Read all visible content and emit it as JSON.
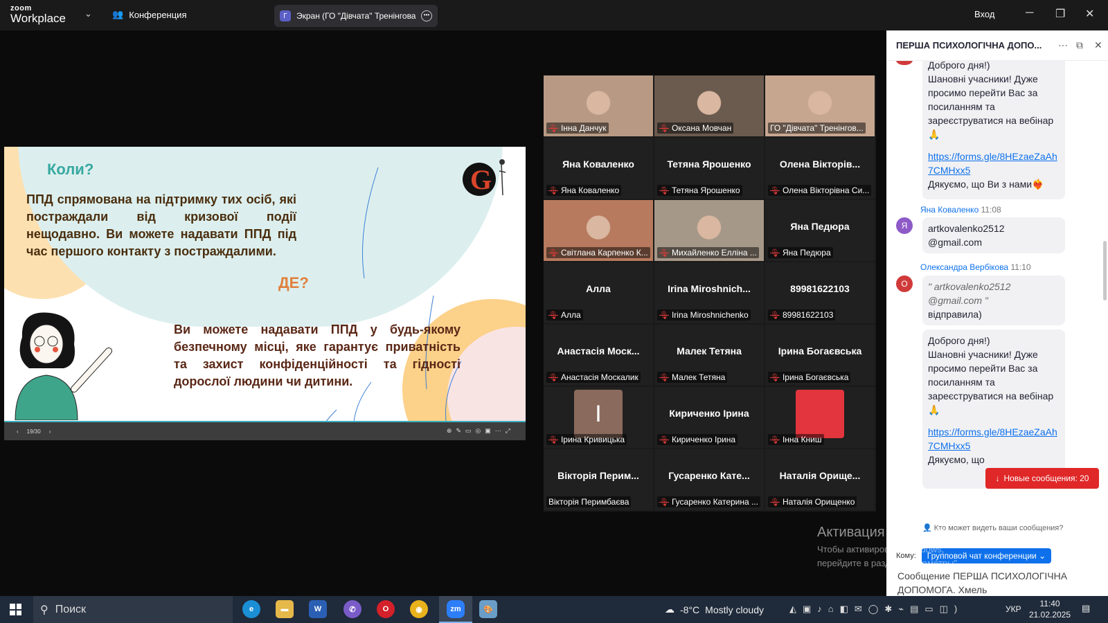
{
  "topbar": {
    "logo_top": "zoom",
    "logo_bottom": "Workplace",
    "conference_label": "Конференция",
    "share_tab_letter": "Г",
    "share_tab_label": "Экран (ГО \"Дівчата\" Тренінгова",
    "login_label": "Вход"
  },
  "slide": {
    "title": "Коли?",
    "para1": "ППД спрямована на підтримку тих осіб, які постраждали від кризової події нещодавно. Ви можете надавати ППД під час першого контакту з постраждалими.",
    "title2": "ДЕ?",
    "para2": "Ви можете надавати ППД у будь-якому безпечному місці, яке гарантує приватність та захист конфіденційності та гідності дорослої людини чи дитини.",
    "page_indicator": "19/30"
  },
  "gallery": {
    "tiles": [
      {
        "name": "",
        "caption": "Інна Данчук",
        "video": true,
        "muted": true,
        "color": "#b89a84"
      },
      {
        "name": "",
        "caption": "Оксана Мовчан",
        "video": true,
        "muted": true,
        "color": "#6b5a4e"
      },
      {
        "name": "",
        "caption": "ГО \"Дівчата\" Тренінгов...",
        "video": true,
        "muted": false,
        "color": "#c7a690",
        "active": true
      },
      {
        "name": "Яна Коваленко",
        "caption": "Яна Коваленко",
        "muted": true
      },
      {
        "name": "Тетяна Ярошенко",
        "caption": "Тетяна Ярошенко",
        "muted": true
      },
      {
        "name": "Олена Вікторів...",
        "caption": "Олена Вікторівна Си...",
        "muted": true
      },
      {
        "name": "",
        "caption": "Світлана Карпенко К...",
        "video": true,
        "muted": true,
        "color": "#b77a5e"
      },
      {
        "name": "",
        "caption": "Михайленко Елліна ...",
        "video": true,
        "muted": true,
        "color": "#a69888"
      },
      {
        "name": "Яна Педюра",
        "caption": "Яна Педюра",
        "muted": true
      },
      {
        "name": "Алла",
        "caption": "Алла",
        "muted": true
      },
      {
        "name": "Irina Miroshnich...",
        "caption": "Irina Miroshnichenko",
        "muted": true
      },
      {
        "name": "89981622103",
        "caption": "89981622103",
        "muted": true
      },
      {
        "name": "Анастасія Моск...",
        "caption": "Анастасія Москалик",
        "muted": true
      },
      {
        "name": "Малек Тетяна",
        "caption": "Малек Тетяна",
        "muted": true
      },
      {
        "name": "Ірина Богаєвська",
        "caption": "Ірина Богаєвська",
        "muted": true
      },
      {
        "name": "",
        "caption": "Ірина Кривицька",
        "muted": true,
        "avatar": "I",
        "avatar_color": "#8a6a5c"
      },
      {
        "name": "Кириченко Ірина",
        "caption": "Кириченко Ірина",
        "muted": true
      },
      {
        "name": "",
        "caption": "Інна Книш",
        "muted": true,
        "avatar": "",
        "avatar_color": "#e3353e"
      },
      {
        "name": "Вікторія Перим...",
        "caption": "Вікторія Перимбаєва",
        "muted": false
      },
      {
        "name": "Гусаренко Кате...",
        "caption": "Гусаренко Катерина ...",
        "muted": true
      },
      {
        "name": "Наталія Орище...",
        "caption": "Наталія Орищенко",
        "muted": true
      }
    ]
  },
  "chat": {
    "title": "ПЕРША ПСИХОЛОГІЧНА ДОПО...",
    "msg1_text_top": "Доброго дня!)",
    "msg1_text": "Шановні учасники! Дуже просимо перейти Вас за посиланням та зареєструватися на вебінар 🙏",
    "msg1_link": "https://forms.gle/8HEzaeZaAh7CMHxx5",
    "msg1_thanks": "Дякуємо, що Ви з нами❤️‍🔥",
    "msg2_sender": "Яна Коваленко",
    "msg2_time": "11:08",
    "msg2_avatar": "Я",
    "msg2_text": "artkovalenko2512 @gmail.com",
    "msg3_sender": "Олександра Вербікова",
    "msg3_time": "11:10",
    "msg3_avatar": "О",
    "msg3_quote": "\" artkovalenko2512 @gmail.com \"",
    "msg3_text": "відправила)",
    "msg4_text_top": "Доброго дня!)",
    "msg4_text": "Шановні учасники! Дуже просимо перейти Вас за посиланням та зареєструватися на вебінар 🙏",
    "msg4_link": "https://forms.gle/8HEzaeZaAh7CMHxx5",
    "msg4_thanks": "Дякуємо, що",
    "new_messages": "Новые сообщения: 20",
    "who_can_see": "Кто может видеть ваши сообщения?",
    "to_label": "Кому:",
    "to_value": "Групповой чат конференции",
    "composer_placeholder": "Сообщение ПЕРША ПСИХОЛОГІЧНА ДОПОМОГА. Хмель"
  },
  "activation": {
    "title": "Активация Windows",
    "text": "Чтобы активировать Windows, перейдите в раздел \"Параметры\"."
  },
  "taskbar": {
    "search_label": "Поиск",
    "weather_temp": "-8°C",
    "weather_text": "Mostly cloudy",
    "weather_badge": "1",
    "lang": "УКР",
    "time": "11:40",
    "date": "21.02.2025",
    "notif_count": "1"
  },
  "colors": {
    "accent": "#0e71eb",
    "active_speaker": "#30d977",
    "alert": "#e02828"
  }
}
